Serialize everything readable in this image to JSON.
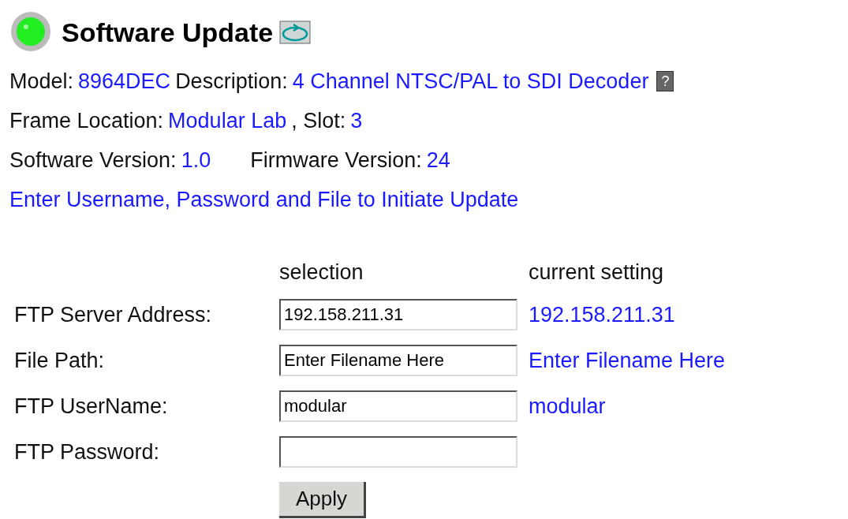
{
  "title": "Software Update",
  "info_lines": [
    [
      {
        "label": "Model:",
        "value": "8964DEC"
      },
      {
        "label": "Description:",
        "value": "4 Channel NTSC/PAL to SDI Decoder",
        "help": "?"
      }
    ],
    [
      {
        "label": "Frame Location:",
        "value": "Modular Lab"
      },
      {
        "label": ", Slot:",
        "value": "3"
      }
    ],
    [
      {
        "label": "Software Version:",
        "value": "1.0"
      },
      {
        "label": "Firmware Version:",
        "value": "24"
      }
    ]
  ],
  "instruction": "Enter Username, Password and File to Initiate Update",
  "form": {
    "columns": [
      "selection",
      "current setting"
    ],
    "rows": [
      {
        "label": "FTP Server Address:",
        "value": "192.158.211.31",
        "current": "192.158.211.31"
      },
      {
        "label": "File Path:",
        "value": "Enter Filename Here",
        "current": "Enter Filename Here"
      },
      {
        "label": "FTP UserName:",
        "value": "modular",
        "current": "modular"
      },
      {
        "label": "FTP Password:"
      }
    ],
    "button": "Apply"
  }
}
